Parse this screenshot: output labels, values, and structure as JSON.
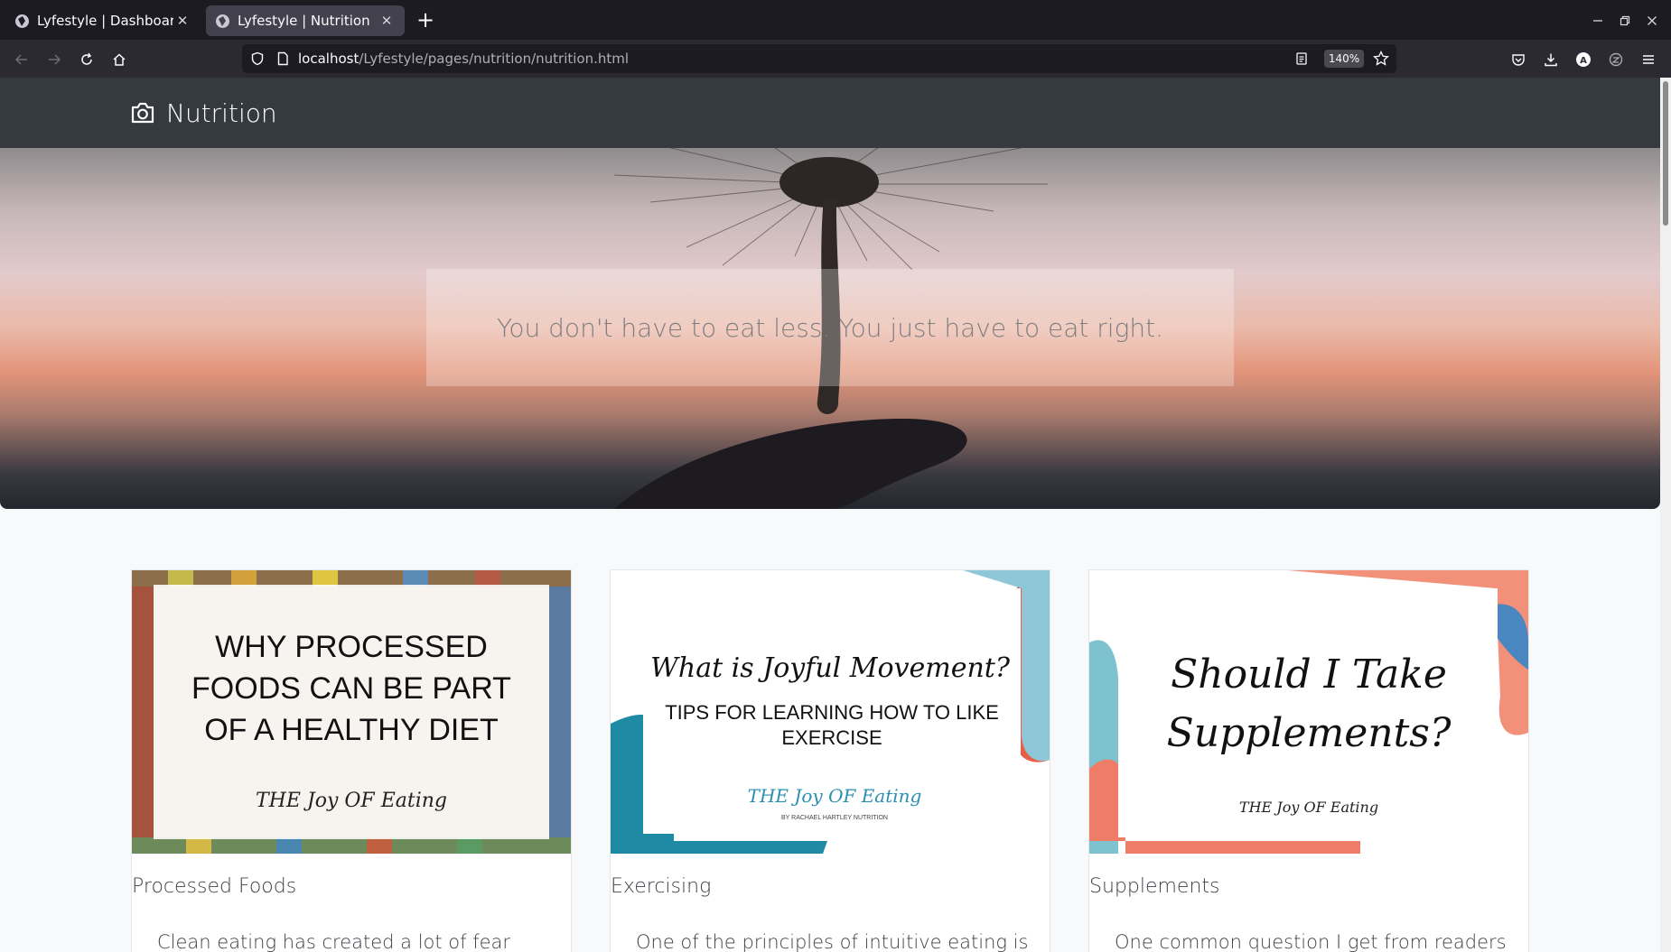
{
  "browser": {
    "tabs": [
      {
        "title": "Lyfestyle | Dashboard",
        "active": false
      },
      {
        "title": "Lyfestyle | Nutrition",
        "active": true
      }
    ],
    "url_host": "localhost",
    "url_path": "/Lyfestyle/pages/nutrition/nutrition.html",
    "zoom": "140%"
  },
  "page": {
    "brand": "Nutrition",
    "hero_quote": "You don't have to eat less. You just have to eat right.",
    "cards": [
      {
        "image_heading": "WHY PROCESSED FOODS CAN BE PART OF A HEALTHY DIET",
        "image_brand": "THE Joy OF Eating",
        "title": "Processed Foods",
        "text": "Clean eating has created a lot of fear"
      },
      {
        "image_script": "What is Joyful Movement?",
        "image_heading": "TIPS FOR LEARNING HOW TO LIKE EXERCISE",
        "image_brand": "THE Joy OF Eating",
        "image_sub": "BY RACHAEL HARTLEY NUTRITION",
        "title": "Exercising",
        "text": "One of the principles of intuitive eating is"
      },
      {
        "image_script": "Should I Take Supplements?",
        "image_brand": "THE Joy OF Eating",
        "title": "Supplements",
        "text": "One common question I get from readers"
      }
    ]
  }
}
